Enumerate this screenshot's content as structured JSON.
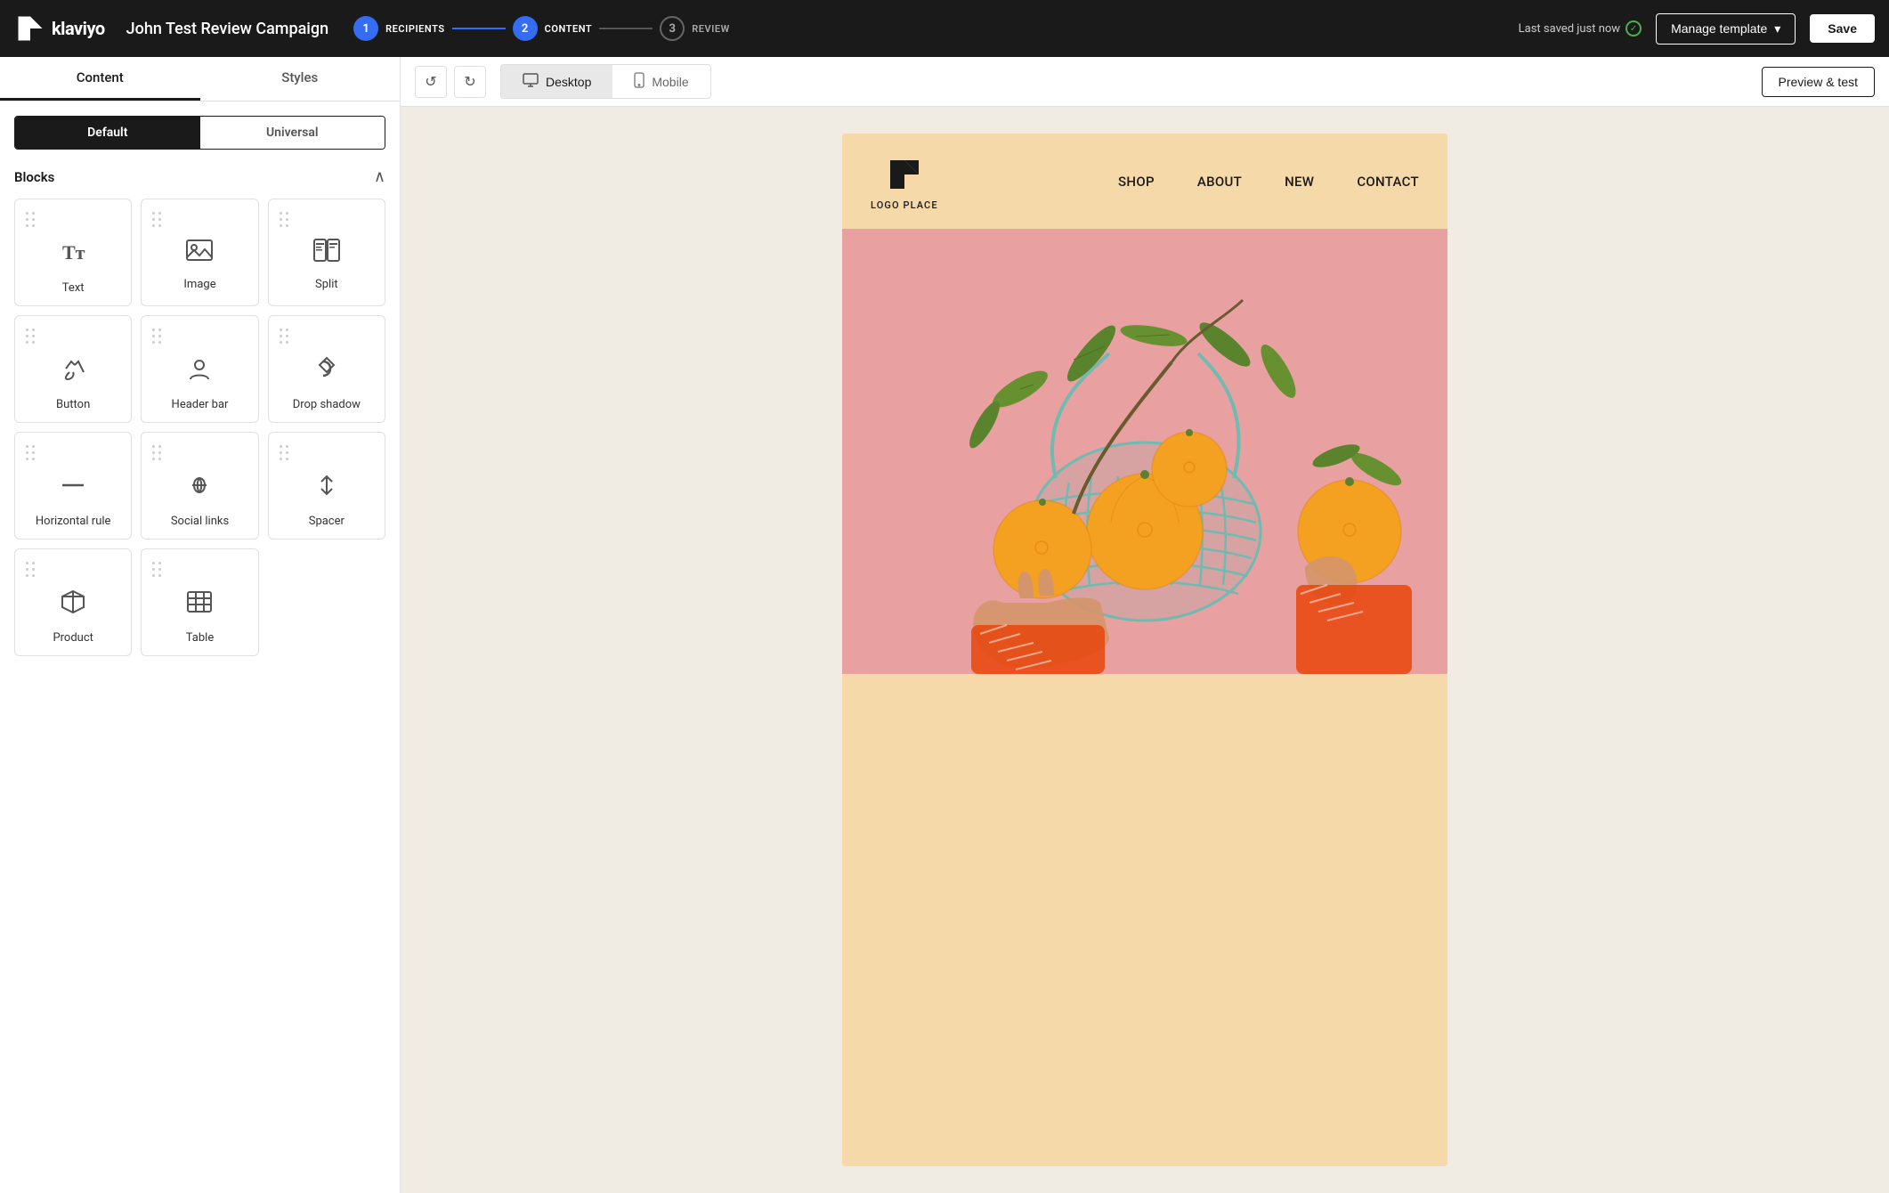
{
  "app": {
    "logo_text": "klaviyo"
  },
  "top_nav": {
    "campaign_title": "John Test Review Campaign",
    "steps": [
      {
        "number": "1",
        "label": "RECIPIENTS",
        "state": "active"
      },
      {
        "number": "2",
        "label": "CONTENT",
        "state": "active"
      },
      {
        "number": "3",
        "label": "REVIEW",
        "state": "inactive"
      }
    ],
    "save_status": "Last saved just now",
    "manage_template_label": "Manage template",
    "save_label": "Save"
  },
  "left_panel": {
    "tabs": [
      {
        "label": "Content",
        "active": true
      },
      {
        "label": "Styles",
        "active": false
      }
    ],
    "toggle_buttons": [
      {
        "label": "Default",
        "active": true
      },
      {
        "label": "Universal",
        "active": false
      }
    ],
    "blocks_title": "Blocks",
    "blocks": [
      {
        "id": "text",
        "label": "Text",
        "icon": "Tt"
      },
      {
        "id": "image",
        "label": "Image",
        "icon": "🖼"
      },
      {
        "id": "split",
        "label": "Split",
        "icon": "⊞"
      },
      {
        "id": "button",
        "label": "Button",
        "icon": "✳"
      },
      {
        "id": "header-bar",
        "label": "Header bar",
        "icon": "👤"
      },
      {
        "id": "drop-shadow",
        "label": "Drop shadow",
        "icon": "◎"
      },
      {
        "id": "horizontal-rule",
        "label": "Horizontal rule",
        "icon": "—"
      },
      {
        "id": "social-links",
        "label": "Social links",
        "icon": "♡"
      },
      {
        "id": "spacer",
        "label": "Spacer",
        "icon": "↕"
      },
      {
        "id": "product",
        "label": "Product",
        "icon": "⬡"
      },
      {
        "id": "table",
        "label": "Table",
        "icon": "⊞"
      }
    ]
  },
  "toolbar": {
    "undo_label": "↺",
    "redo_label": "↻",
    "desktop_label": "Desktop",
    "mobile_label": "Mobile",
    "preview_test_label": "Preview & test"
  },
  "email_preview": {
    "header": {
      "logo_text": "LOGO PLACE",
      "nav_items": [
        "SHOP",
        "ABOUT",
        "NEW",
        "CONTACT"
      ]
    },
    "background_color": "#f5d9a8"
  }
}
